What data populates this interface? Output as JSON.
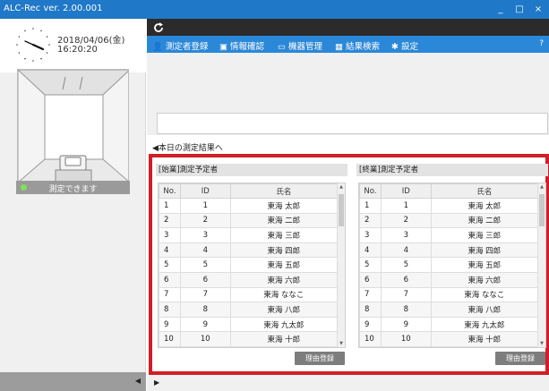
{
  "window": {
    "title": "ALC-Rec  ver. 2.00.001",
    "minimize_glyph": "_",
    "maximize_glyph": "□",
    "close_glyph": "×"
  },
  "clock": {
    "date": "2018/04/06(金)",
    "time": "16:20:20"
  },
  "status": {
    "text": "測定できます",
    "indicator_color": "#7fe05a"
  },
  "left_bottom_arrow": "◀",
  "menu": {
    "items": [
      {
        "icon": "person-icon",
        "glyph": "👤",
        "label": "測定者登録"
      },
      {
        "icon": "info-card-icon",
        "glyph": "▣",
        "label": "情報確認"
      },
      {
        "icon": "device-icon",
        "glyph": "▭",
        "label": "機器管理"
      },
      {
        "icon": "calendar-icon",
        "glyph": "▦",
        "label": "結果検索"
      },
      {
        "icon": "gear-icon",
        "glyph": "✱",
        "label": "設定"
      }
    ],
    "help": "?"
  },
  "message_box": "",
  "today_link": "◀本日の測定結果へ",
  "panels": [
    {
      "title": "[始業]測定予定者",
      "columns": [
        "No.",
        "ID",
        "氏名"
      ],
      "rows": [
        [
          "1",
          "1",
          "東海  太郎"
        ],
        [
          "2",
          "2",
          "東海  二郎"
        ],
        [
          "3",
          "3",
          "東海  三郎"
        ],
        [
          "4",
          "4",
          "東海  四郎"
        ],
        [
          "5",
          "5",
          "東海  五郎"
        ],
        [
          "6",
          "6",
          "東海  六郎"
        ],
        [
          "7",
          "7",
          "東海  ななこ"
        ],
        [
          "8",
          "8",
          "東海  八郎"
        ],
        [
          "9",
          "9",
          "東海  九太郎"
        ],
        [
          "10",
          "10",
          "東海  十郎"
        ]
      ],
      "button": "理由登録"
    },
    {
      "title": "[終業]測定予定者",
      "columns": [
        "No.",
        "ID",
        "氏名"
      ],
      "rows": [
        [
          "1",
          "1",
          "東海  太郎"
        ],
        [
          "2",
          "2",
          "東海  二郎"
        ],
        [
          "3",
          "3",
          "東海  三郎"
        ],
        [
          "4",
          "4",
          "東海  四郎"
        ],
        [
          "5",
          "5",
          "東海  五郎"
        ],
        [
          "6",
          "6",
          "東海  六郎"
        ],
        [
          "7",
          "7",
          "東海  ななこ"
        ],
        [
          "8",
          "8",
          "東海  八郎"
        ],
        [
          "9",
          "9",
          "東海  九太郎"
        ],
        [
          "10",
          "10",
          "東海  十郎"
        ]
      ],
      "button": "理由登録"
    }
  ],
  "bottom_arrow": "▶",
  "colors": {
    "titlebar": "#1f78c8",
    "menubar": "#2b88d8",
    "highlight_frame": "#d01f26"
  }
}
